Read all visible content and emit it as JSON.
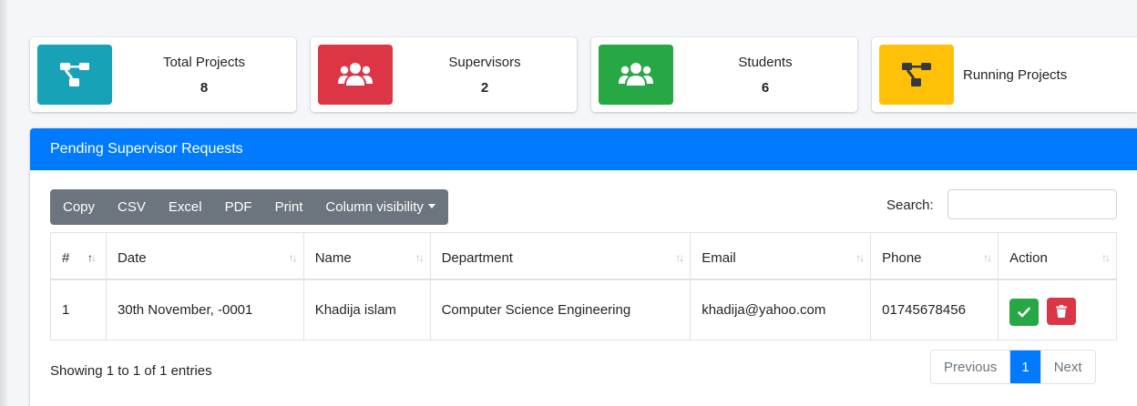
{
  "colors": {
    "info_teal": "#17a2b8",
    "info_red": "#dc3545",
    "info_green": "#28a745",
    "info_yellow": "#ffc107",
    "header_blue": "#007bff",
    "button_gray": "#6c757d"
  },
  "info_boxes": [
    {
      "label": "Total Projects",
      "value": "8",
      "icon": "project-diagram-icon",
      "color": "#17a2b8"
    },
    {
      "label": "Supervisors",
      "value": "2",
      "icon": "users-icon",
      "color": "#dc3545"
    },
    {
      "label": "Students",
      "value": "6",
      "icon": "users-icon",
      "color": "#28a745"
    },
    {
      "label": "Running Projects",
      "value": "",
      "icon": "project-diagram-icon",
      "color": "#ffc107"
    }
  ],
  "card": {
    "title": "Pending Supervisor Requests"
  },
  "export_buttons": {
    "copy": "Copy",
    "csv": "CSV",
    "excel": "Excel",
    "pdf": "PDF",
    "print": "Print",
    "column_visibility": "Column visibility"
  },
  "search": {
    "label": "Search:",
    "value": "",
    "placeholder": ""
  },
  "table": {
    "headers": [
      "#",
      "Date",
      "Name",
      "Department",
      "Email",
      "Phone",
      "Action"
    ],
    "rows": [
      {
        "num": "1",
        "date": "30th November, -0001",
        "name": "Khadija islam",
        "department": "Computer Science Engineering",
        "email": "khadija@yahoo.com",
        "phone": "01745678456",
        "actions": [
          "check-icon",
          "trash-icon"
        ]
      }
    ]
  },
  "footer": {
    "info": "Showing 1 to 1 of 1 entries",
    "previous": "Previous",
    "current_page": "1",
    "next": "Next"
  }
}
